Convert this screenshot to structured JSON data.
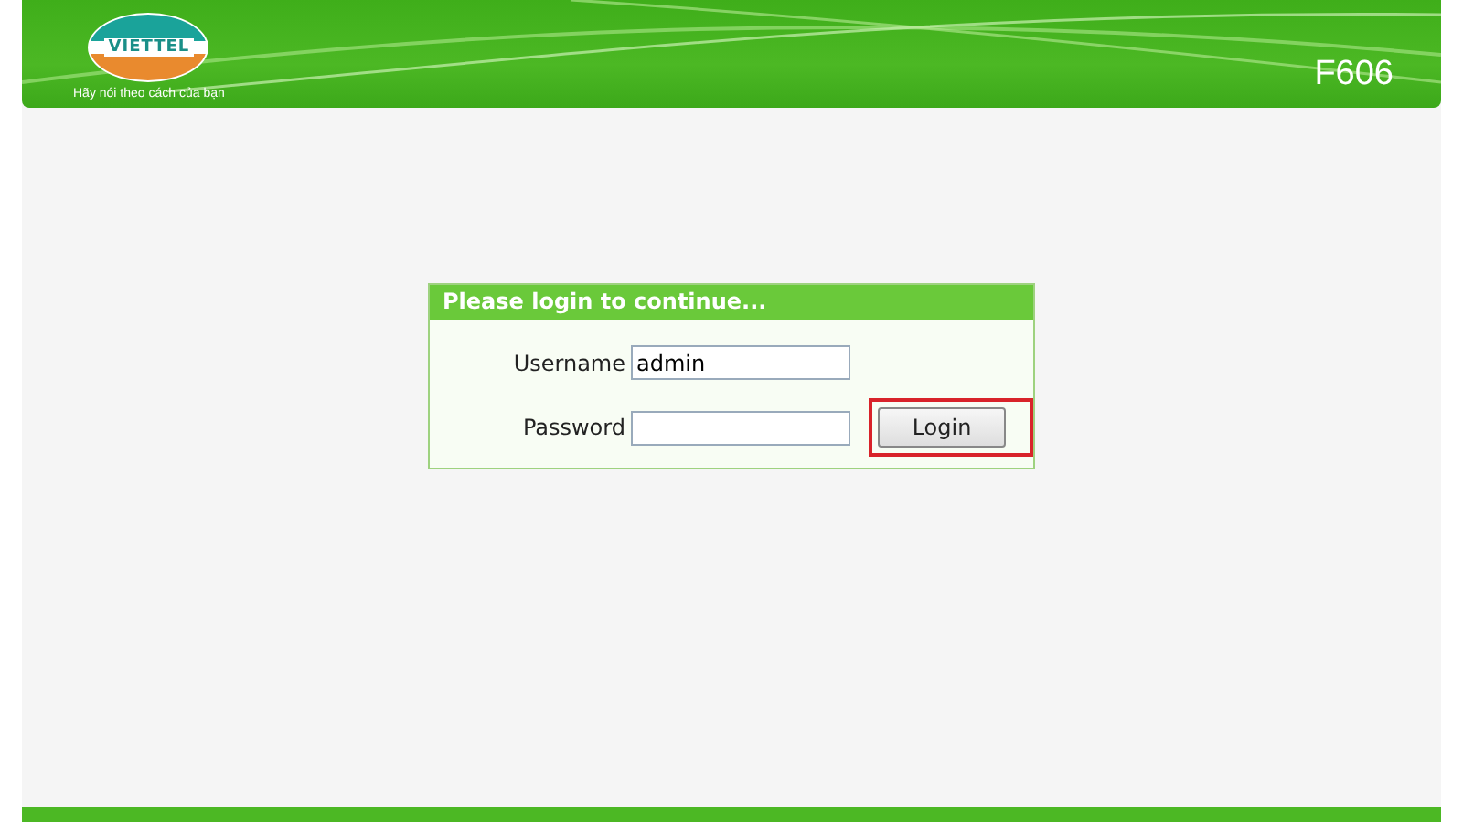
{
  "header": {
    "logo_text": "VIETTEL",
    "slogan": "Hãy nói theo cách của bạn",
    "model": "F606"
  },
  "login": {
    "title": "Please login to continue...",
    "fields": [
      {
        "label": "Username",
        "value": "admin"
      },
      {
        "label": "Password"
      }
    ],
    "button": {
      "label": "Login",
      "highlighted": true
    }
  }
}
